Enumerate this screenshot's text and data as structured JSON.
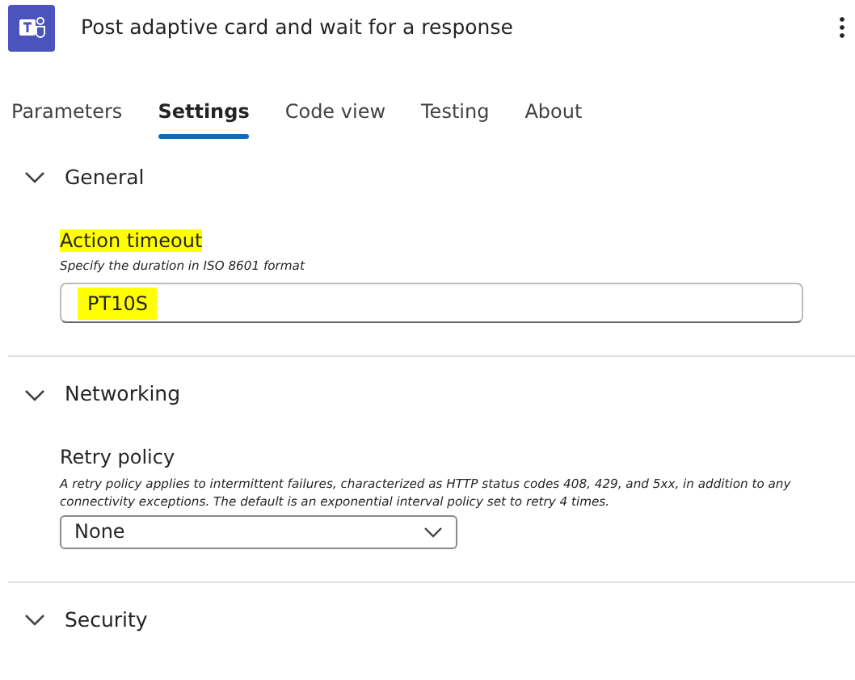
{
  "header": {
    "title": "Post adaptive card and wait for a response"
  },
  "tabs": [
    {
      "label": "Parameters",
      "selected": false
    },
    {
      "label": "Settings",
      "selected": true
    },
    {
      "label": "Code view",
      "selected": false
    },
    {
      "label": "Testing",
      "selected": false
    },
    {
      "label": "About",
      "selected": false
    }
  ],
  "sections": [
    {
      "title": "General",
      "expanded": true,
      "fields": [
        {
          "kind": "text",
          "label": "Action timeout",
          "hint": "Specify the duration in ISO 8601 format",
          "value": "PT10S",
          "highlighted": true
        }
      ]
    },
    {
      "title": "Networking",
      "expanded": true,
      "fields": [
        {
          "kind": "select",
          "label": "Retry policy",
          "hint": "A retry policy applies to intermittent failures, characterized as HTTP status codes 408, 429, and 5xx, in addition to any connectivity exceptions. The default is an exponential interval policy set to retry 4 times.",
          "value": "None",
          "highlighted": false
        }
      ]
    },
    {
      "title": "Security",
      "expanded": true
    }
  ]
}
